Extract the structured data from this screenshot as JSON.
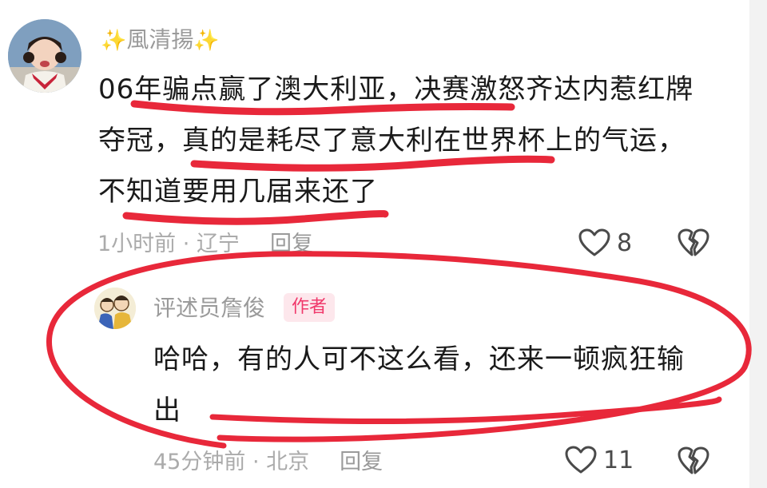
{
  "comment": {
    "username": "風清揚",
    "text_lines": [
      "06年骗点赢了澳大利亚，决赛激怒齐达内惹红牌",
      "夺冠，真的是耗尽了意大利在世界杯上的气运，",
      "不知道要用几届来还了"
    ],
    "time": "1小时前",
    "location": "辽宁",
    "reply_label": "回复",
    "likes": "8"
  },
  "reply": {
    "username": "评述员詹俊",
    "badge": "作者",
    "text_lines": [
      "哈哈，有的人可不这么看，还来一顿疯狂输",
      "出"
    ],
    "time": "45分钟前",
    "location": "北京",
    "reply_label": "回复",
    "likes": "11"
  },
  "icons": {
    "like": "heart-outline-icon",
    "dislike": "broken-heart-icon",
    "sparkle": "sparkle-emoji-icon"
  },
  "colors": {
    "annotation": "#e8283a",
    "badge_bg": "#fde7ec",
    "badge_text": "#f0396b",
    "muted": "#ababab"
  }
}
